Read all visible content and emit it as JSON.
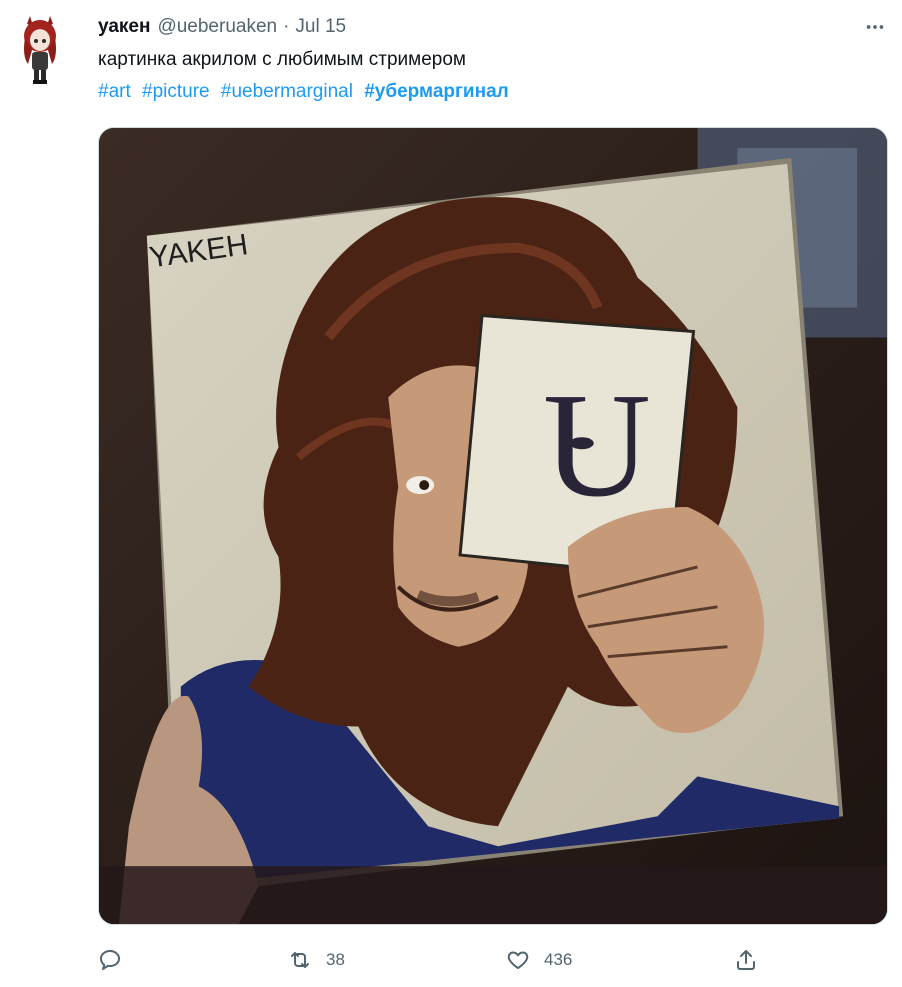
{
  "author": {
    "display_name": "уакен",
    "handle": "@ueberuaken",
    "separator": "·",
    "timestamp": "Jul 15"
  },
  "tweet": {
    "text": "картинка акрилом с любимым стримером",
    "hashtags": [
      {
        "label": "#art",
        "bold": false
      },
      {
        "label": "#picture",
        "bold": false
      },
      {
        "label": "#uebermarginal",
        "bold": false
      },
      {
        "label": "#убермаргинал",
        "bold": true
      }
    ]
  },
  "media": {
    "signature_text": "YAKEH",
    "card_letter": "U"
  },
  "actions": {
    "reply_count": "",
    "retweet_count": "38",
    "like_count": "436",
    "share_count": ""
  },
  "icons": {
    "more": "more-horizontal-icon",
    "reply": "reply-icon",
    "retweet": "retweet-icon",
    "like": "heart-icon",
    "share": "share-icon"
  },
  "colors": {
    "link": "#1d9bf0",
    "muted": "#536471",
    "text": "#0f1419",
    "border": "#cfd9de"
  }
}
